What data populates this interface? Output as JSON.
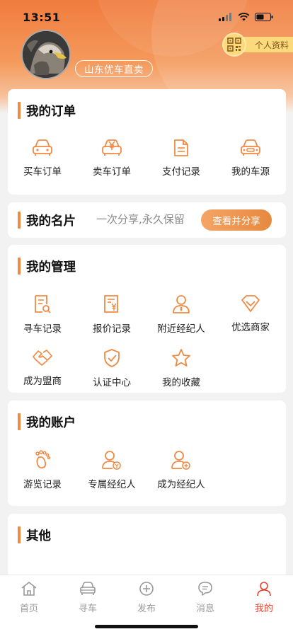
{
  "status_bar": {
    "time": "13:51"
  },
  "profile": {
    "name": "山东优车直卖",
    "profile_button_label": "个人资料"
  },
  "orders": {
    "title": "我的订单",
    "items": [
      {
        "label": "买车订单",
        "icon": "car-icon"
      },
      {
        "label": "卖车订单",
        "icon": "yuan-car-icon"
      },
      {
        "label": "支付记录",
        "icon": "document-icon"
      },
      {
        "label": "我的车源",
        "icon": "car-source-icon"
      }
    ]
  },
  "business_card": {
    "title": "我的名片",
    "subtitle": "一次分享,永久保留",
    "button_label": "查看并分享"
  },
  "management": {
    "title": "我的管理",
    "items": [
      {
        "label": "寻车记录",
        "icon": "search-document-icon"
      },
      {
        "label": "报价记录",
        "icon": "price-document-icon"
      },
      {
        "label": "附近经纪人",
        "icon": "person-icon"
      },
      {
        "label": "优选商家",
        "icon": "diamond-icon"
      },
      {
        "label": "成为盟商",
        "icon": "handshake-icon"
      },
      {
        "label": "认证中心",
        "icon": "shield-check-icon"
      },
      {
        "label": "我的收藏",
        "icon": "star-icon"
      }
    ]
  },
  "account": {
    "title": "我的账户",
    "items": [
      {
        "label": "游览记录",
        "icon": "footprint-icon"
      },
      {
        "label": "专属经纪人",
        "icon": "person-badge-icon"
      },
      {
        "label": "成为经纪人",
        "icon": "person-add-icon"
      }
    ]
  },
  "other": {
    "title": "其他"
  },
  "tabbar": {
    "tabs": [
      {
        "label": "首页",
        "icon": "home-icon",
        "active": false
      },
      {
        "label": "寻车",
        "icon": "car-icon",
        "active": false
      },
      {
        "label": "发布",
        "icon": "plus-circle-icon",
        "active": false
      },
      {
        "label": "消息",
        "icon": "message-icon",
        "active": false
      },
      {
        "label": "我的",
        "icon": "user-icon",
        "active": true
      }
    ]
  },
  "colors": {
    "accent": "#f08a43",
    "header_gradient_top": "#f07c3e",
    "active_tab": "#e8442e",
    "badge_yellow": "#fcd97a"
  }
}
